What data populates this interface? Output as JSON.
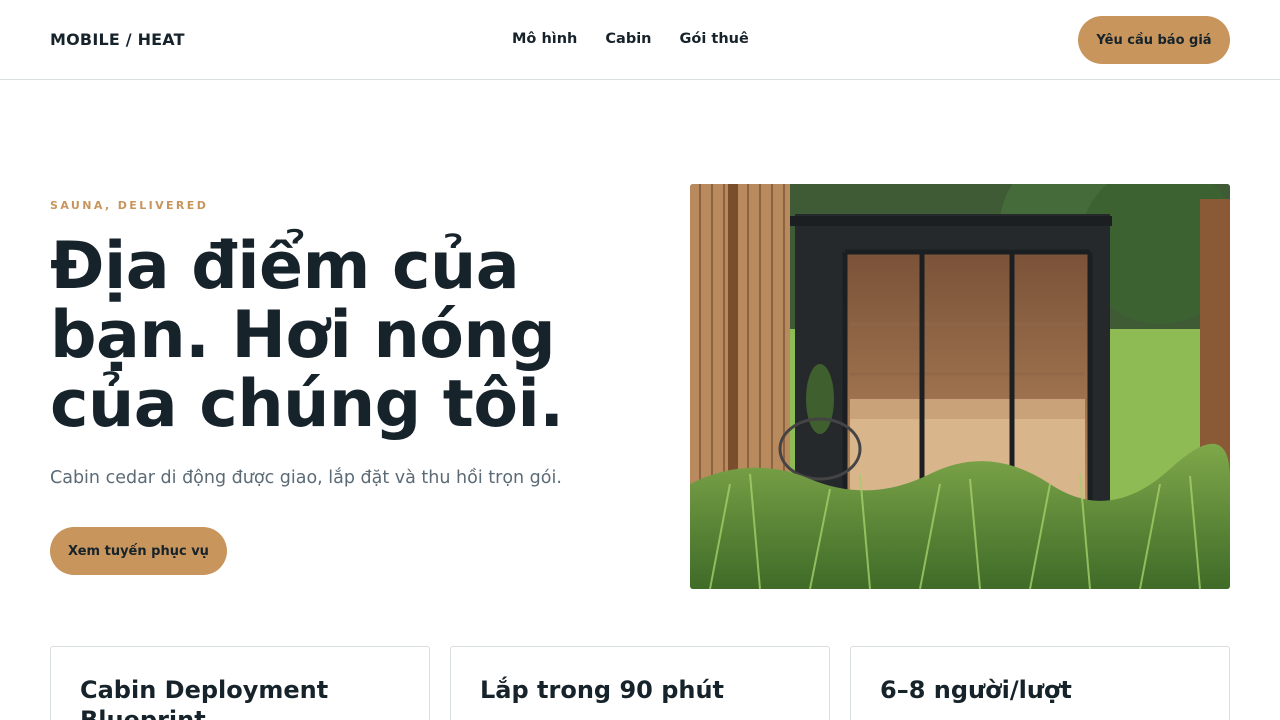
{
  "header": {
    "logo": "MOBILE / HEAT",
    "nav": [
      "Mô hình",
      "Cabin",
      "Gói thuê"
    ],
    "cta_label": "Yêu cầu báo giá"
  },
  "hero": {
    "eyebrow": "SAUNA, DELIVERED",
    "title_line1": "Địa điểm của",
    "title_line2": "bạn. Hơi nóng",
    "title_line3": "của chúng tôi.",
    "subtitle": "Cabin cedar di động được giao, lắp đặt và thu hồi trọn gói.",
    "cta_label": "Xem tuyến phục vụ",
    "image_alt": "Cabin sauna gỗ cedar trên bãi cỏ"
  },
  "cards": [
    {
      "title": "Cabin Deployment Blueprint"
    },
    {
      "title": "Lắp trong 90 phút"
    },
    {
      "title": "6–8 người/lượt"
    }
  ],
  "colors": {
    "accent": "#c8955c",
    "text": "#17232b",
    "muted": "#5b6b76",
    "border": "#d9dee1"
  }
}
